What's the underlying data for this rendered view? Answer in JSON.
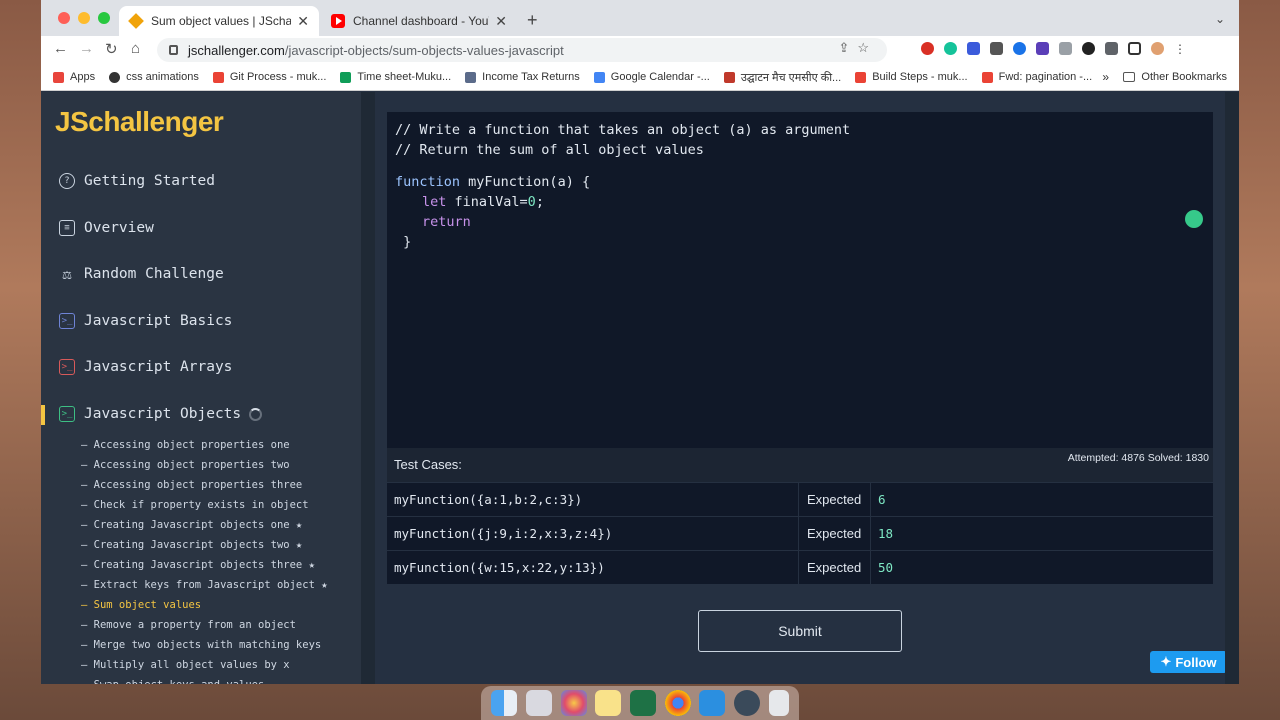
{
  "browser": {
    "tabs": [
      {
        "title": "Sum object values | JSchalleng",
        "active": true
      },
      {
        "title": "Channel dashboard - YouTube",
        "active": false
      }
    ],
    "url_host": "jschallenger.com",
    "url_path": "/javascript-objects/sum-objects-values-javascript",
    "bookmarks": [
      {
        "label": "Apps",
        "color": "#e8453c"
      },
      {
        "label": "css animations",
        "color": "#333333"
      },
      {
        "label": "Git Process - muk...",
        "color": "#ea4335"
      },
      {
        "label": "Time sheet-Muku...",
        "color": "#0f9d58"
      },
      {
        "label": "Income Tax Returns",
        "color": "#5b6b8a"
      },
      {
        "label": "Google Calendar -...",
        "color": "#4285f4"
      },
      {
        "label": "उद्घाटन मैच एमसीए की...",
        "color": "#c0392b"
      },
      {
        "label": "Build Steps - muk...",
        "color": "#ea4335"
      },
      {
        "label": "Fwd: pagination -...",
        "color": "#ea4335"
      }
    ],
    "bookmarks_more": "»",
    "other_bookmarks": "Other Bookmarks"
  },
  "sidebar": {
    "logo": "JSchallenger",
    "nav": [
      {
        "label": "Getting Started",
        "icon": "question-circle-icon",
        "glyph": "?"
      },
      {
        "label": "Overview",
        "icon": "clipboard-icon",
        "glyph": "≡"
      },
      {
        "label": "Random Challenge",
        "icon": "scale-icon",
        "glyph": "⚖"
      },
      {
        "label": "Javascript Basics",
        "icon": "terminal-icon",
        "glyph": ">_"
      },
      {
        "label": "Javascript Arrays",
        "icon": "terminal-icon",
        "glyph": ">_"
      },
      {
        "label": "Javascript Objects",
        "icon": "terminal-icon",
        "glyph": ">_"
      }
    ],
    "sub_items": [
      "– Accessing object properties one",
      "– Accessing object properties two",
      "– Accessing object properties three",
      "– Check if property exists in object",
      "– Creating Javascript objects one ★",
      "– Creating Javascript objects two ★",
      "– Creating Javascript objects three ★",
      "– Extract keys from Javascript object ★",
      "– Sum object values",
      "– Remove a property from an object",
      "– Merge two objects with matching keys",
      "– Multiply all object values by x",
      "– Swap object keys and values"
    ],
    "current_sub_index": 8
  },
  "editor": {
    "comment1": "// Write a function that takes an object (a) as argument",
    "comment2": "// Return the sum of all object values",
    "kw_function": "function",
    "fn_sig": " myFunction(a) {",
    "kw_let": "let",
    "let_rest": " finalVal=",
    "let_num": "0",
    "let_end": ";",
    "kw_return": "return",
    "close": " }"
  },
  "tests": {
    "title": "Test Cases:",
    "attempts": "Attempted: 4876  Solved: 1830",
    "expected_label": "Expected",
    "rows": [
      {
        "call": "myFunction({a:1,b:2,c:3})",
        "expected": "6"
      },
      {
        "call": "myFunction({j:9,i:2,x:3,z:4})",
        "expected": "18"
      },
      {
        "call": "myFunction({w:15,x:22,y:13})",
        "expected": "50"
      }
    ]
  },
  "submit_label": "Submit",
  "follow_label": "Follow",
  "colors": {
    "accent": "#f4c542",
    "comment": "#4ade80",
    "twitter": "#1d9bf0"
  }
}
